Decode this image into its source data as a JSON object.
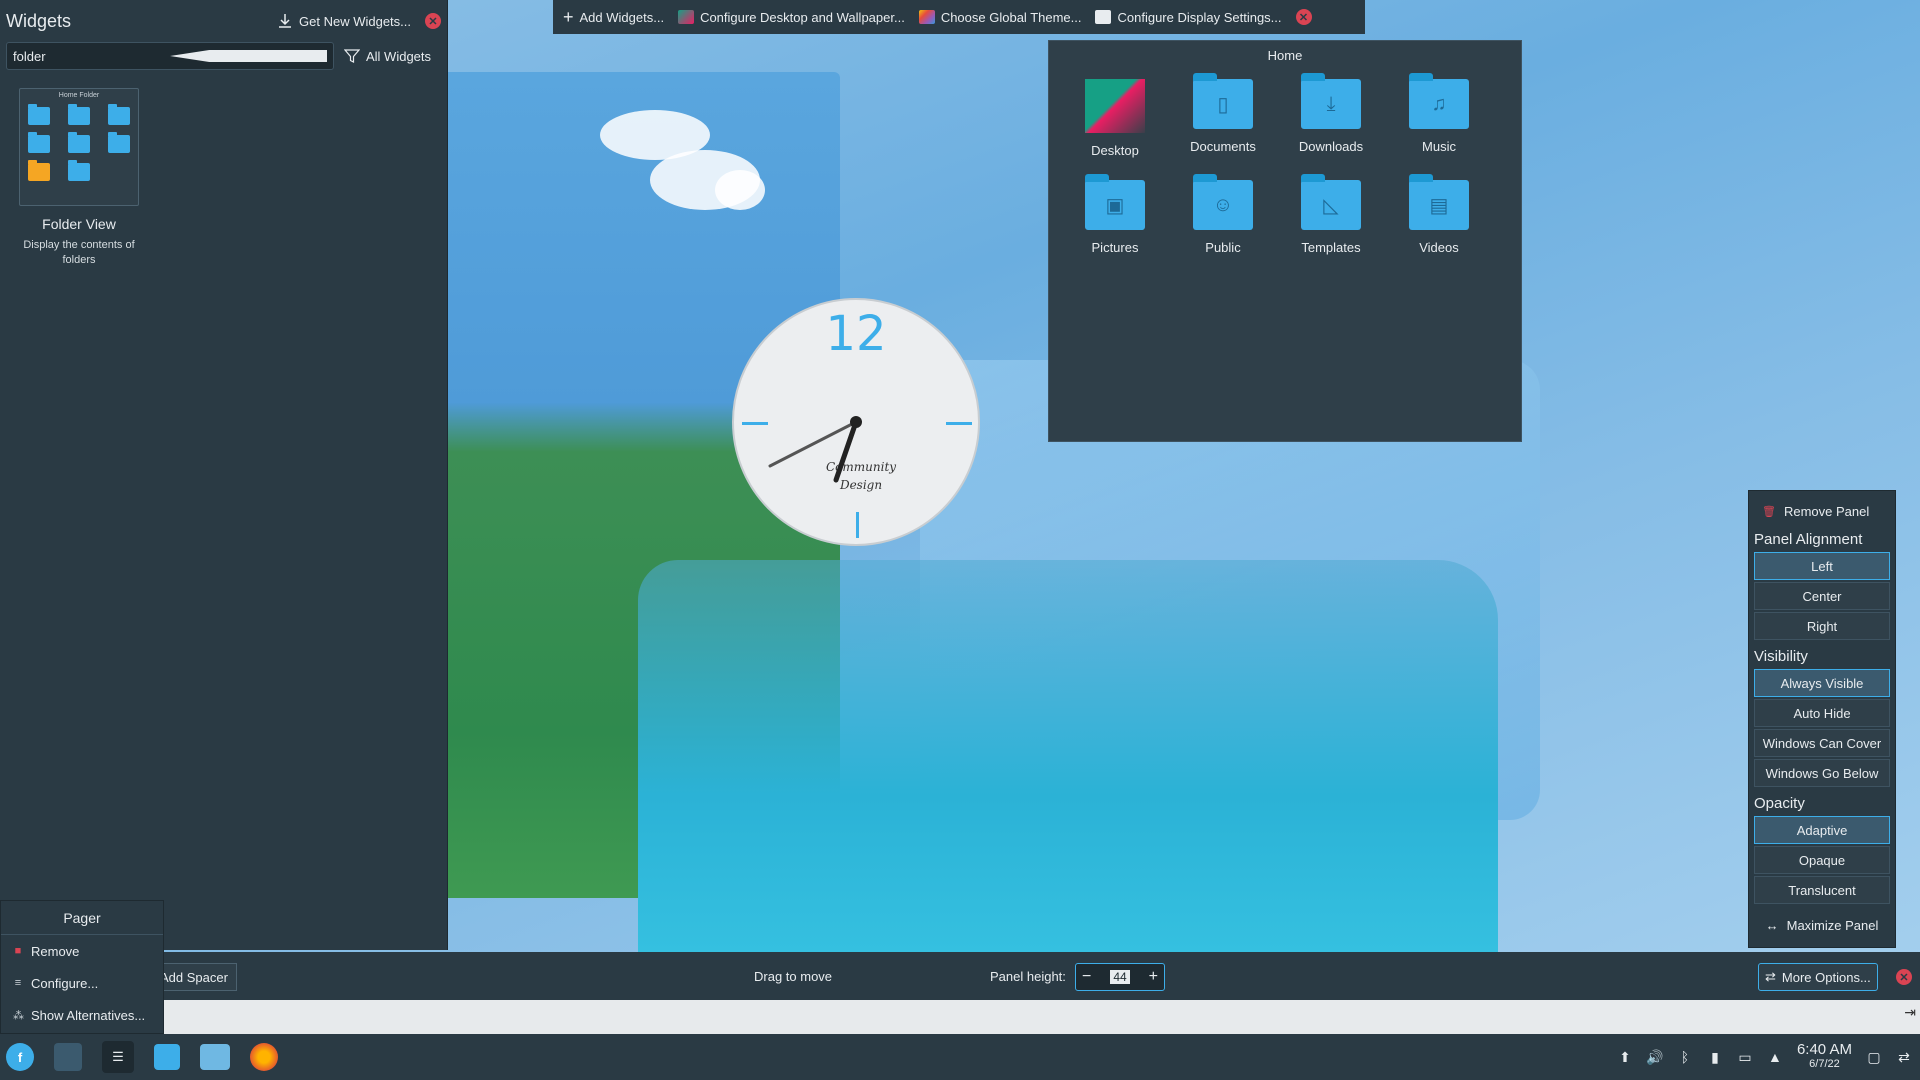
{
  "widgets_panel": {
    "title": "Widgets",
    "get_new": "Get New Widgets...",
    "search_value": "folder",
    "filter": "All Widgets",
    "widget": {
      "thumb_title": "Home Folder",
      "name": "Folder View",
      "description": "Display the contents of folders"
    }
  },
  "pager_menu": {
    "title": "Pager",
    "items": [
      {
        "label": "Remove",
        "icon": "trash-icon"
      },
      {
        "label": "Configure...",
        "icon": "configure-icon"
      },
      {
        "label": "Show Alternatives...",
        "icon": "alternatives-icon"
      }
    ]
  },
  "top_toolbar": {
    "add_widgets": "Add Widgets...",
    "configure_desktop": "Configure Desktop and Wallpaper...",
    "choose_theme": "Choose Global Theme...",
    "display_settings": "Configure Display Settings..."
  },
  "folder_view": {
    "title": "Home",
    "items": [
      {
        "label": "Desktop",
        "icon": "desktop-folder-icon"
      },
      {
        "label": "Documents",
        "icon": "documents-folder-icon"
      },
      {
        "label": "Downloads",
        "icon": "downloads-folder-icon"
      },
      {
        "label": "Music",
        "icon": "music-folder-icon"
      },
      {
        "label": "Pictures",
        "icon": "pictures-folder-icon"
      },
      {
        "label": "Public",
        "icon": "public-folder-icon"
      },
      {
        "label": "Templates",
        "icon": "templates-folder-icon"
      },
      {
        "label": "Videos",
        "icon": "videos-folder-icon"
      }
    ]
  },
  "clock": {
    "numeral": "12",
    "brand_line1": "Community",
    "brand_line2": "Design"
  },
  "panel_edit": {
    "add_spacer": "Add Spacer",
    "drag_to_move": "Drag to move",
    "height_label": "Panel height:",
    "height_value": "44",
    "more_options": "More Options..."
  },
  "more_options": {
    "remove_panel": "Remove Panel",
    "alignment_heading": "Panel Alignment",
    "alignment": [
      "Left",
      "Center",
      "Right"
    ],
    "alignment_active": "Left",
    "visibility_heading": "Visibility",
    "visibility": [
      "Always Visible",
      "Auto Hide",
      "Windows Can Cover",
      "Windows Go Below"
    ],
    "visibility_active": "Always Visible",
    "opacity_heading": "Opacity",
    "opacity": [
      "Adaptive",
      "Opaque",
      "Translucent"
    ],
    "opacity_active": "Adaptive",
    "maximize": "Maximize Panel"
  },
  "taskbar": {
    "time": "6:40 AM",
    "date": "6/7/22"
  },
  "colors": {
    "accent": "#3daee9",
    "panel_bg": "#2a3a44",
    "close_red": "#da4453"
  }
}
